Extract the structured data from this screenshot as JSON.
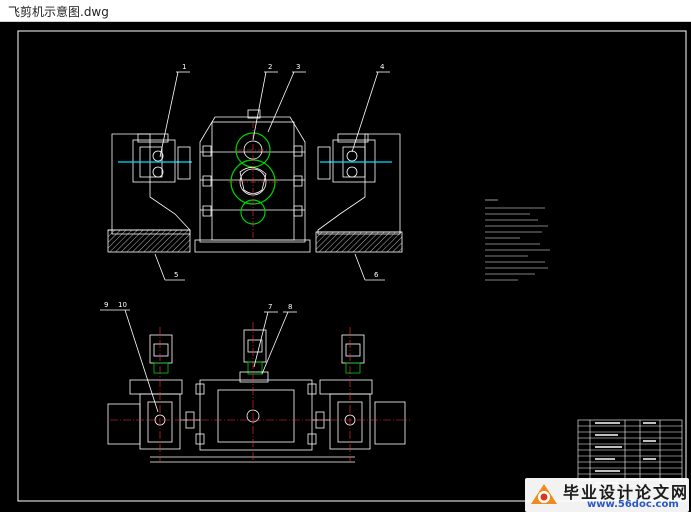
{
  "window": {
    "title": "飞剪机示意图.dwg"
  },
  "drawing": {
    "part_labels": [
      "1",
      "2",
      "3",
      "4",
      "5",
      "6",
      "7",
      "8",
      "9",
      "10"
    ],
    "colors": {
      "background": "#000000",
      "outline": "#ffffff",
      "hatch": "#ffffff",
      "center_line": "#ff3030",
      "gear": "#00d000",
      "accent": "#00e0ff"
    }
  },
  "watermark": {
    "title": "毕业设计论文网",
    "url": "www.56doc.com"
  }
}
